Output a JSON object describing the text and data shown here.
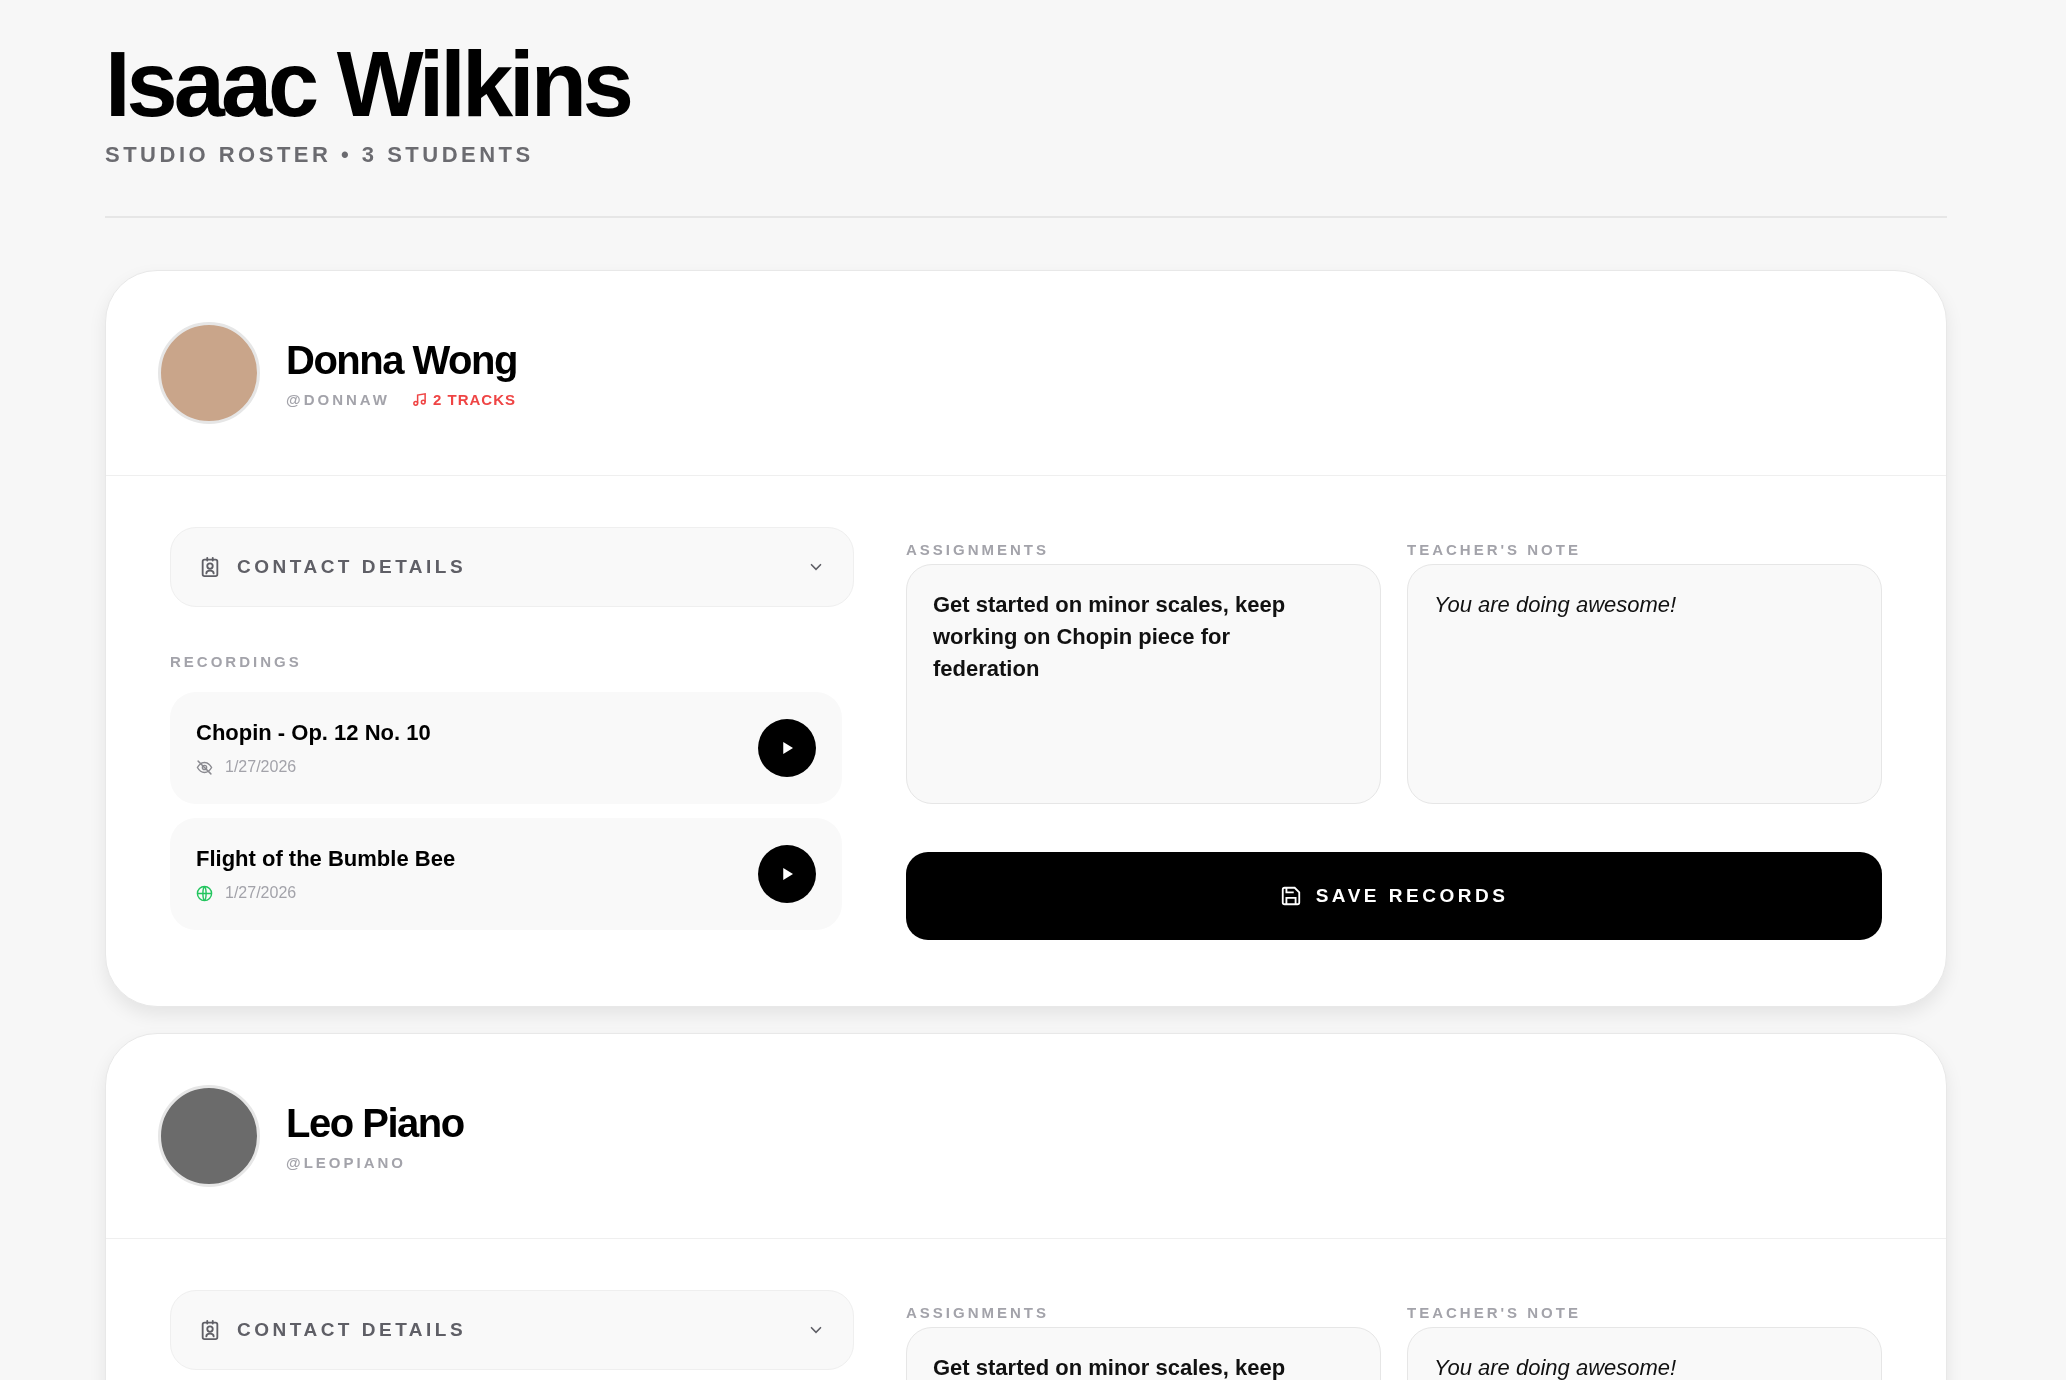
{
  "header": {
    "title": "Isaac Wilkins",
    "subtitle": "STUDIO ROSTER • 3 STUDENTS"
  },
  "students": [
    {
      "name": "Donna Wong",
      "handle": "@DONNAW",
      "tracks": "2 TRACKS",
      "contact_label": "CONTACT DETAILS",
      "recordings_label": "RECORDINGS",
      "recordings": [
        {
          "title": "Chopin - Op. 12 No. 10",
          "date": "1/27/2026",
          "kind": "private"
        },
        {
          "title": "Flight of the Bumble Bee",
          "date": "1/27/2026",
          "kind": "public"
        }
      ],
      "assignments_label": "ASSIGNMENTS",
      "assignments": "Get started on minor scales, keep working on Chopin piece for federation",
      "note_label": "TEACHER'S NOTE",
      "note": "You are doing awesome!",
      "save_label": "SAVE RECORDS"
    },
    {
      "name": "Leo Piano",
      "handle": "@LEOPIANO",
      "contact_label": "CONTACT DETAILS",
      "assignments_label": "ASSIGNMENTS",
      "assignments": "Get started on minor scales, keep",
      "note_label": "TEACHER'S NOTE",
      "note": "You are doing awesome!"
    }
  ]
}
